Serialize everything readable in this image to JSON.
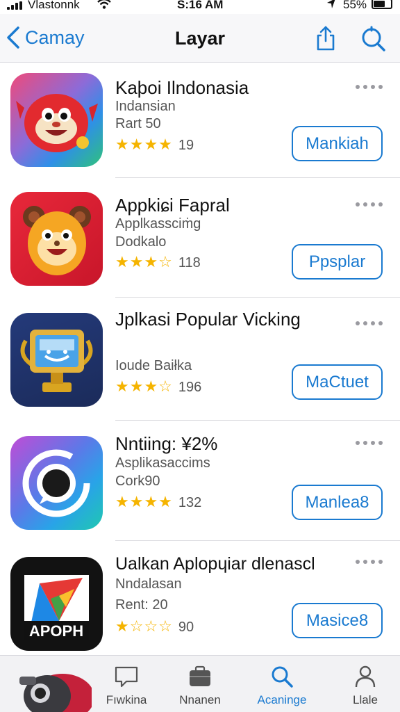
{
  "status_bar": {
    "carrier": "Vlastonnk",
    "time": "S:16 AM",
    "battery": "55%"
  },
  "nav": {
    "back_label": "Camay",
    "title": "Layar"
  },
  "apps": [
    {
      "name": "Kaþoi Ilndonasia",
      "line1": "Indansian",
      "line2": "Rart 50",
      "rating": 4,
      "rating_count": "19",
      "button": "Mankiah",
      "icon": "red-mascot-icon"
    },
    {
      "name": "Appkiɕi Fapral",
      "line1": "Applkassciṁg",
      "line2": "Dodkalo",
      "rating": 3.5,
      "rating_count": "118",
      "button": "Ppsplar",
      "icon": "bear-mascot-icon"
    },
    {
      "name": "Jplkasi Popular Vicking",
      "line1": "",
      "line2": "Ioude Baiłka",
      "rating": 3.5,
      "rating_count": "196",
      "button": "MaCtuet",
      "icon": "trophy-screen-icon"
    },
    {
      "name": "Nntiing: ¥2%",
      "line1": "Asplikasaccims",
      "line2": "Cork90",
      "rating": 4,
      "rating_count": "132",
      "button": "Manlea8",
      "icon": "chat-ring-icon"
    },
    {
      "name": "Ualkan Aplopɥiar dlenascl",
      "line1": "Nndalasan",
      "line2": "Rent: 20",
      "rating": 1,
      "rating_count": "90",
      "button": "Masice8",
      "icon": "apoph-play-icon",
      "icon_text": "APOPH"
    }
  ],
  "tabs": [
    {
      "label": "Fıwkina",
      "icon": "message-icon",
      "active": false
    },
    {
      "label": "Nnanen",
      "icon": "briefcase-icon",
      "active": false
    },
    {
      "label": "Acaninge",
      "icon": "search-icon",
      "active": true
    },
    {
      "label": "Llale",
      "icon": "person-icon",
      "active": false
    }
  ],
  "colors": {
    "accent": "#1a7ad0",
    "star": "#f5b400"
  }
}
